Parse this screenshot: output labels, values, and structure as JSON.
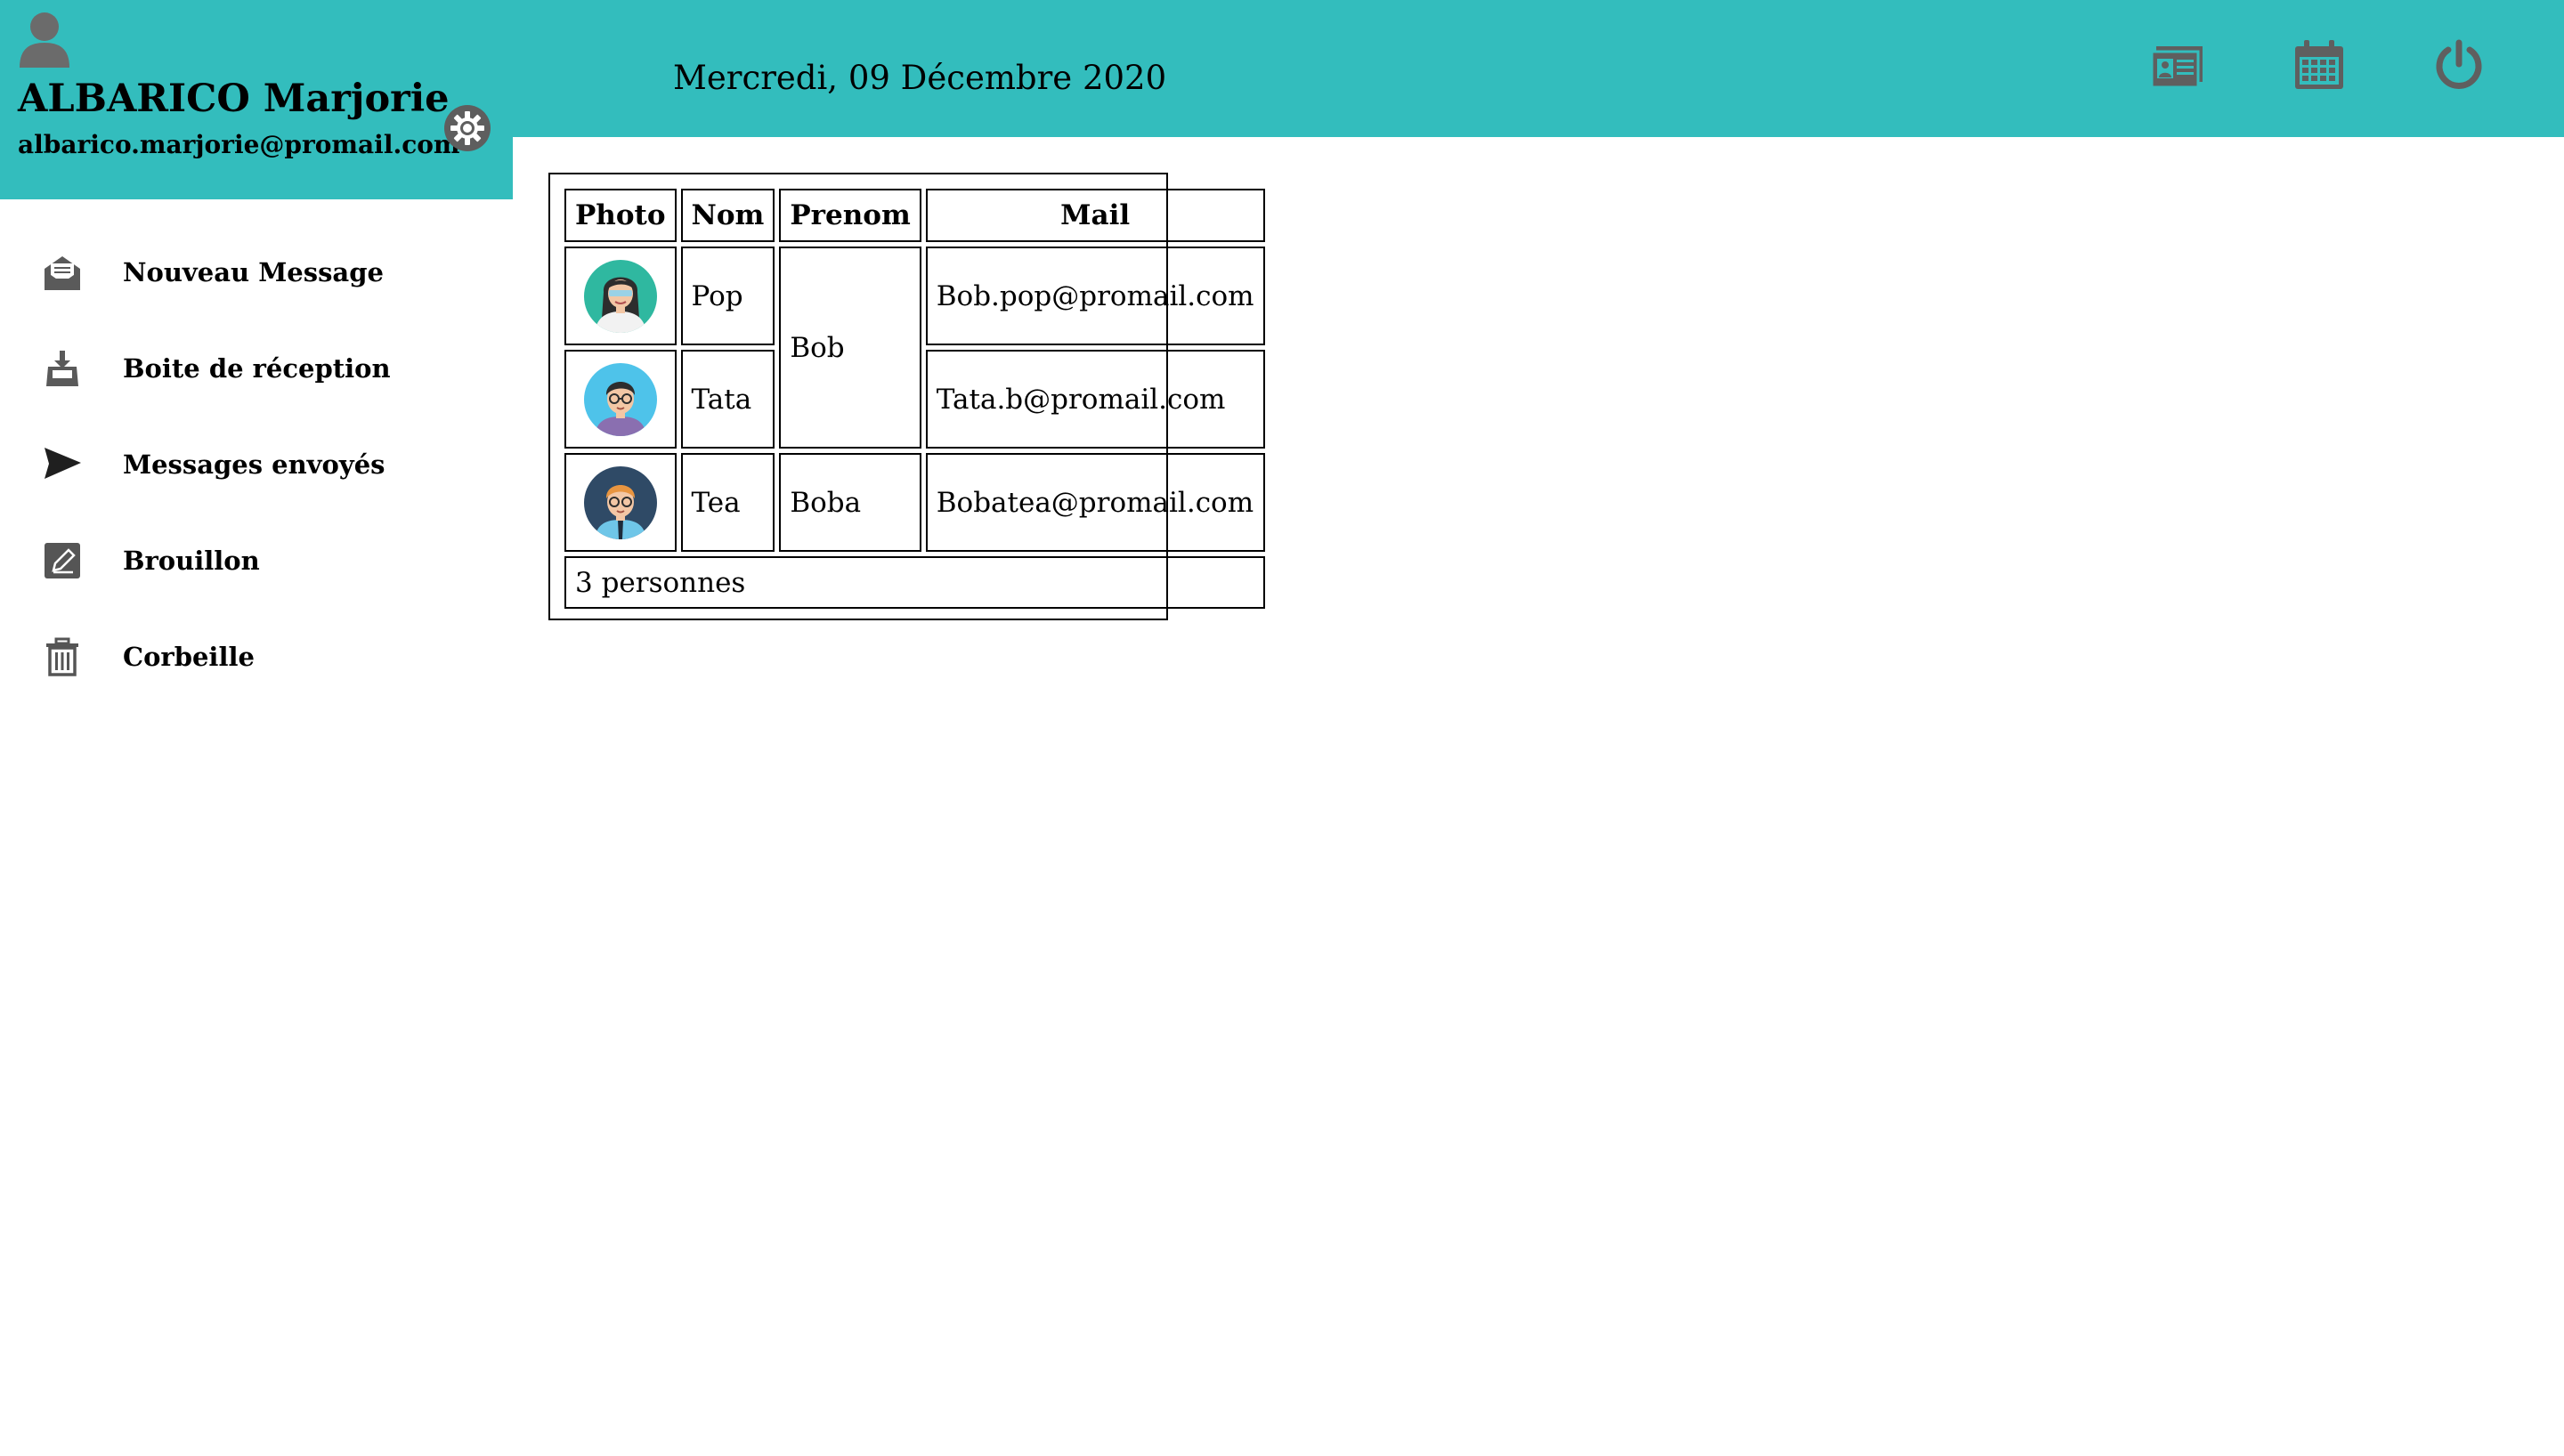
{
  "header": {
    "user_name": "ALBARICO Marjorie",
    "user_email": "albarico.marjorie@promail.com",
    "date": "Mercredi, 09 Décembre 2020",
    "brand_color": "#33bdbd",
    "icons": [
      "user-icon",
      "gear-icon",
      "contact-card-icon",
      "calendar-icon",
      "power-icon"
    ]
  },
  "sidebar": {
    "items": [
      {
        "label": "Nouveau Message",
        "icon": "open-envelope-icon"
      },
      {
        "label": "Boite de réception",
        "icon": "inbox-tray-icon"
      },
      {
        "label": "Messages envoyés",
        "icon": "paper-plane-icon"
      },
      {
        "label": "Brouillon",
        "icon": "pencil-square-icon"
      },
      {
        "label": "Corbeille",
        "icon": "trash-icon"
      }
    ]
  },
  "table": {
    "headers": [
      "Photo",
      "Nom",
      "Prenom",
      "Mail"
    ],
    "rows": [
      {
        "nom": "Pop",
        "prenom": "Bob",
        "mail": "Bob.pop@promail.com",
        "photo": "woman-avatar"
      },
      {
        "nom": "Tata",
        "prenom": "Bob",
        "mail": "Tata.b@promail.com",
        "photo": "man-glasses-avatar"
      },
      {
        "nom": "Tea",
        "prenom": "Boba",
        "mail": "Bobatea@promail.com",
        "photo": "man-tie-avatar"
      }
    ],
    "footer": "3 personnes"
  }
}
